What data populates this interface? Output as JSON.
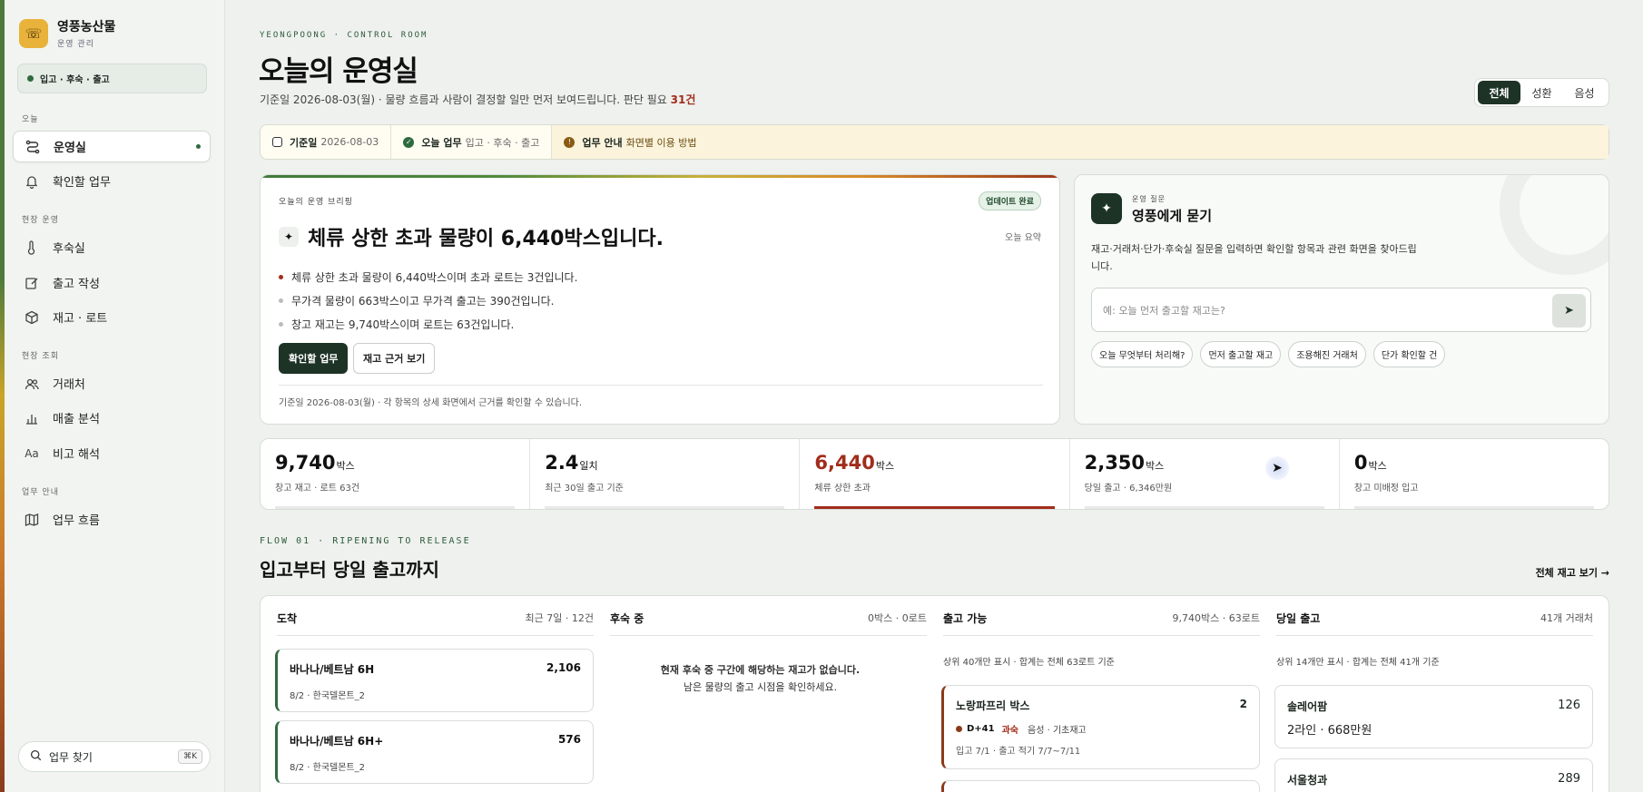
{
  "sidebar": {
    "brand_name": "영풍농산물",
    "brand_sub": "운영 관리",
    "status": "입고 · 후숙 · 출고",
    "sections": {
      "today": "오늘",
      "field_ops": "현장 운영",
      "field_query": "현장 조회",
      "guide": "업무 안내"
    },
    "items": [
      {
        "label": "운영실",
        "icon": "route-icon"
      },
      {
        "label": "확인할 업무",
        "icon": "bell-icon"
      },
      {
        "label": "후숙실",
        "icon": "thermometer-icon"
      },
      {
        "label": "출고 작성",
        "icon": "edit-icon"
      },
      {
        "label": "재고 · 로트",
        "icon": "box-icon"
      },
      {
        "label": "거래처",
        "icon": "users-icon"
      },
      {
        "label": "매출 분석",
        "icon": "bar-chart-icon"
      },
      {
        "label": "비고 해석",
        "icon": "text-icon"
      },
      {
        "label": "업무 흐름",
        "icon": "map-icon"
      }
    ],
    "search_label": "업무 찾기",
    "search_kbd": "⌘K"
  },
  "header": {
    "eyebrow": "YEONGPOONG · CONTROL ROOM",
    "title": "오늘의 운영실",
    "subtitle_pre": "기준일 2026-08-03(월) · 물량 흐름과 사람이 결정할 일만 먼저 보여드립니다. 판단 필요 ",
    "subtitle_count": "31건",
    "segments": [
      "전체",
      "성환",
      "음성"
    ]
  },
  "context_bar": {
    "date_label": "기준일",
    "date_value": "2026-08-03",
    "today_label": "오늘 업무",
    "today_value": "입고 · 후숙 · 출고",
    "guide_label": "업무 안내",
    "guide_value": "화면별 이용 방법"
  },
  "brief": {
    "label": "오늘의 운영 브리핑",
    "badge": "업데이트 완료",
    "summary_tag": "오늘 요약",
    "headline": "체류 상한 초과 물량이 6,440박스입니다.",
    "bullets": [
      "체류 상한 초과 물량이 6,440박스이며 초과 로트는 3건입니다.",
      "무가격 물량이 663박스이고 무가격 출고는 390건입니다.",
      "창고 재고는 9,740박스이며 로트는 63건입니다."
    ],
    "btn_primary": "확인할 업무",
    "btn_secondary": "재고 근거 보기",
    "footer": "기준일 2026-08-03(월) · 각 항목의 상세 화면에서 근거를 확인할 수 있습니다."
  },
  "ask": {
    "eyebrow": "운영 질문",
    "title": "영풍에게 묻기",
    "desc": "재고·거래처·단가·후숙실 질문을 입력하면 확인할 항목과 관련 화면을 찾아드립니다.",
    "placeholder": "예: 오늘 먼저 출고할 재고는?",
    "chips": [
      "오늘 무엇부터 처리해?",
      "먼저 출고할 재고",
      "조용해진 거래처",
      "단가 확인할 건"
    ]
  },
  "metrics": [
    {
      "value": "9,740",
      "unit": "박스",
      "label": "창고 재고 · 로트 63건"
    },
    {
      "value": "2.4",
      "unit": "일치",
      "label": "최근 30일 출고 기준"
    },
    {
      "value": "6,440",
      "unit": "박스",
      "label": "체류 상한 초과"
    },
    {
      "value": "2,350",
      "unit": "박스",
      "label": "당일 출고 · 6,346만원"
    },
    {
      "value": "0",
      "unit": "박스",
      "label": "창고 미배정 입고"
    }
  ],
  "flow": {
    "eyebrow": "FLOW 01 · RIPENING TO RELEASE",
    "title": "입고부터 당일 출고까지",
    "link": "전체 재고 보기 →",
    "arrival": {
      "title": "도착",
      "meta": "최근 7일 · 12건",
      "cards": [
        {
          "name": "바나나/베트남 6H",
          "qty": "2,106",
          "sub": "8/2 · 한국델몬트_2"
        },
        {
          "name": "바나나/베트남 6H+",
          "qty": "576",
          "sub": "8/2 · 한국델몬트_2"
        }
      ]
    },
    "ripening": {
      "title": "후숙 중",
      "meta": "0박스 · 0로트",
      "empty_title": "현재 후숙 중 구간에 해당하는 재고가 없습니다.",
      "empty_sub": "남은 물량의 출고 시점을 확인하세요."
    },
    "ready": {
      "title": "출고 가능",
      "meta": "9,740박스 · 63로트",
      "note": "상위 40개만 표시 · 합계는 전체 63로트 기준",
      "cards": [
        {
          "name": "노랑파프리 박스",
          "qty": "2",
          "dday": "D+41",
          "tag": "과숙",
          "extra": "음성 · 기초재고",
          "sub": "입고 7/1 · 출고 적기 7/7~7/11"
        }
      ]
    },
    "today": {
      "title": "당일 출고",
      "meta": "41개 거래처",
      "note": "상위 14개만 표시 · 합계는 전체 41개 기준",
      "cards": [
        {
          "name": "솔레어팜",
          "qty": "126",
          "sub": "2라인 · 668만원"
        },
        {
          "name": "서울청과",
          "qty": "289"
        }
      ]
    }
  },
  "colors": {
    "accent_dark": "#1d3326",
    "alert_red": "#a12d1c",
    "brand_yellow": "#e9b23a"
  }
}
